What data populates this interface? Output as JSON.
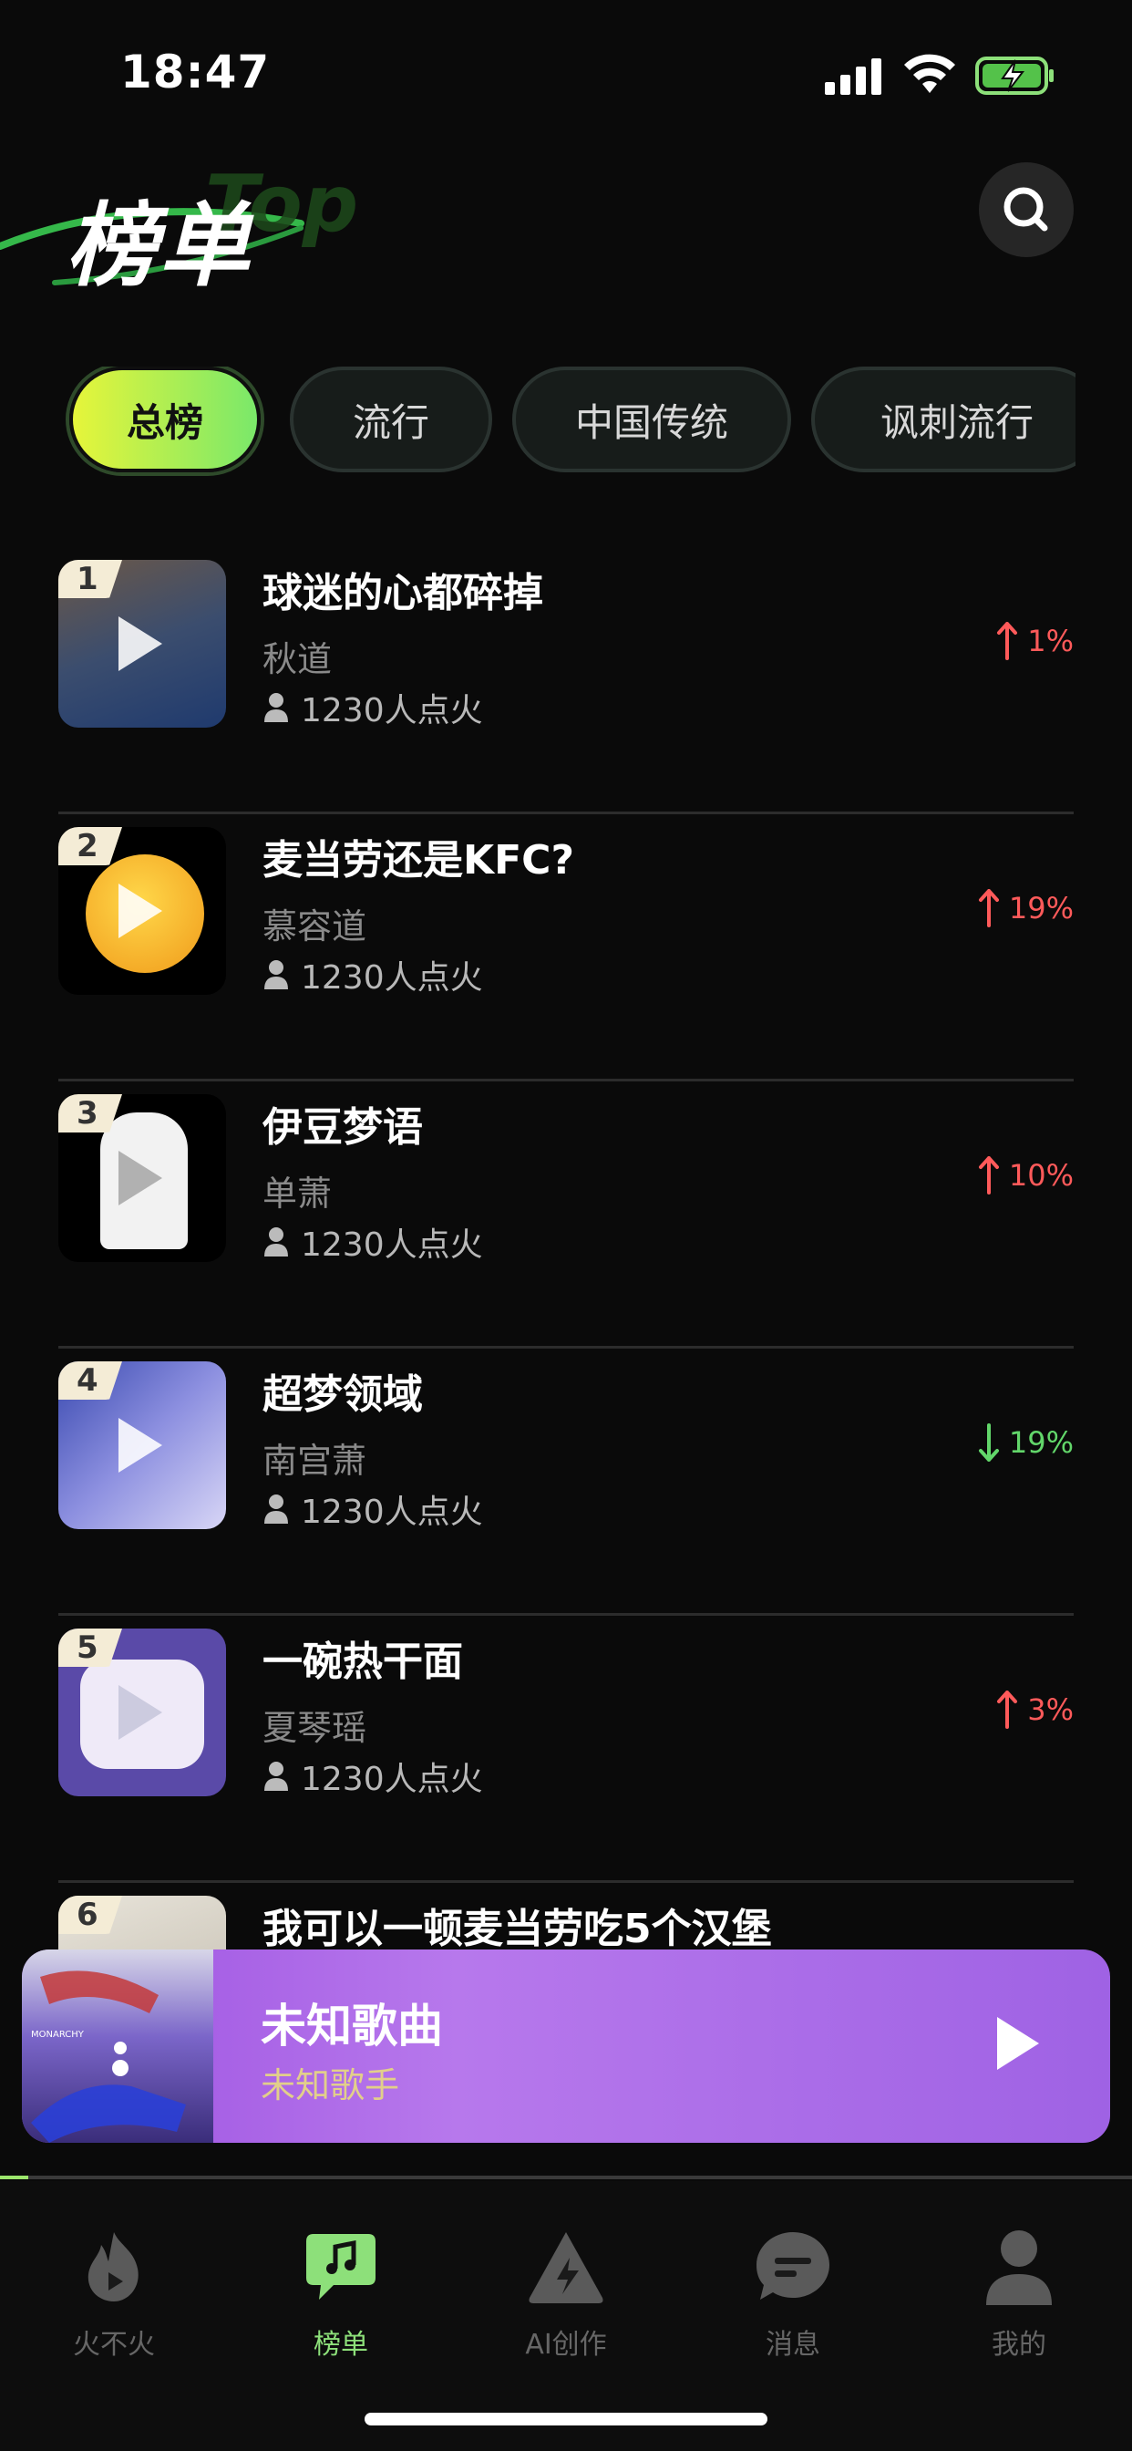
{
  "status_bar": {
    "time": "18:47"
  },
  "header": {
    "title": "榜单",
    "decoration": "Top"
  },
  "tabs": [
    {
      "label": "总榜",
      "active": true
    },
    {
      "label": "流行",
      "active": false
    },
    {
      "label": "中国传统",
      "active": false
    },
    {
      "label": "讽刺流行",
      "active": false
    }
  ],
  "songs": [
    {
      "rank": "1",
      "title": "球迷的心都碎掉",
      "artist": "秋道",
      "fire": "1230人点火",
      "trend": "up",
      "change": "1%",
      "thumb_colors": [
        "#5a4a3c",
        "#1f3a6e"
      ]
    },
    {
      "rank": "2",
      "title": "麦当劳还是KFC?",
      "artist": "慕容道",
      "fire": "1230人点火",
      "trend": "up",
      "change": "19%",
      "thumb_colors": [
        "#000000",
        "#f3b32a"
      ]
    },
    {
      "rank": "3",
      "title": "伊豆梦语",
      "artist": "单萧",
      "fire": "1230人点火",
      "trend": "up",
      "change": "10%",
      "thumb_colors": [
        "#000000",
        "#f2f2f2"
      ]
    },
    {
      "rank": "4",
      "title": "超梦领域",
      "artist": "南宫萧",
      "fire": "1230人点火",
      "trend": "down",
      "change": "19%",
      "thumb_colors": [
        "#4a56b6",
        "#c9c8f0"
      ]
    },
    {
      "rank": "5",
      "title": "一碗热干面",
      "artist": "夏琴瑶",
      "fire": "1230人点火",
      "trend": "up",
      "change": "3%",
      "thumb_colors": [
        "#6a5ab0",
        "#e8e4f8"
      ]
    },
    {
      "rank": "6",
      "title": "我可以一顿麦当劳吃5个汉堡",
      "artist": "",
      "fire": "",
      "trend": "",
      "change": "",
      "thumb_colors": [
        "#cfcac0",
        "#f2efe8"
      ]
    }
  ],
  "mini_player": {
    "title": "未知歌曲",
    "artist": "未知歌手",
    "cover_text": "MONARCHY",
    "progress": 0.025
  },
  "tabbar": [
    {
      "label": "火不火",
      "icon": "flame-play-icon",
      "active": false
    },
    {
      "label": "榜单",
      "icon": "music-chat-icon",
      "active": true
    },
    {
      "label": "AI创作",
      "icon": "ai-bolt-icon",
      "active": false
    },
    {
      "label": "消息",
      "icon": "message-bubble-icon",
      "active": false
    },
    {
      "label": "我的",
      "icon": "profile-icon",
      "active": false
    }
  ],
  "colors": {
    "accent_green": "#8de07a",
    "trend_up": "#ff5a5a",
    "trend_down": "#62d66a",
    "player_purple": "#a46ae6"
  }
}
